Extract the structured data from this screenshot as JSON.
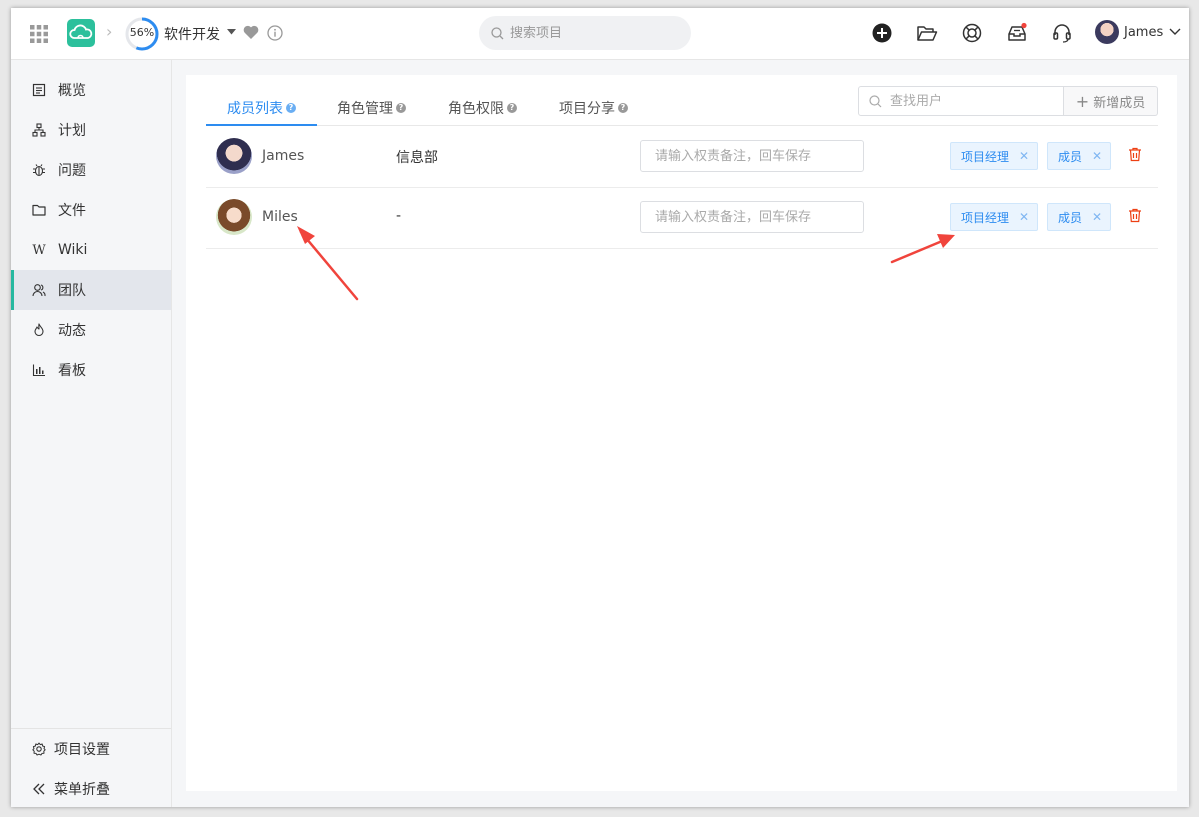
{
  "topbar": {
    "progress_percent": 56,
    "progress_label": "56%",
    "project_name": "软件开发",
    "search_placeholder": "搜索项目",
    "user_name": "James",
    "icons": [
      "apps-grid-icon",
      "cloud-logo",
      "heart-icon",
      "info-icon",
      "add-circle-icon",
      "folder-open-icon",
      "lifebuoy-icon",
      "inbox-icon",
      "headset-icon"
    ]
  },
  "sidebar": {
    "items": [
      {
        "label": "概览",
        "icon": "overview-icon"
      },
      {
        "label": "计划",
        "icon": "plan-icon"
      },
      {
        "label": "问题",
        "icon": "bug-icon"
      },
      {
        "label": "文件",
        "icon": "folder-icon"
      },
      {
        "label": "Wiki",
        "icon": "wiki-icon"
      },
      {
        "label": "团队",
        "icon": "team-icon",
        "active": true
      },
      {
        "label": "动态",
        "icon": "fire-icon"
      },
      {
        "label": "看板",
        "icon": "chart-icon"
      }
    ],
    "settings_label": "项目设置",
    "collapse_label": "菜单折叠"
  },
  "main": {
    "tabs": [
      {
        "label": "成员列表",
        "active": true
      },
      {
        "label": "角色管理"
      },
      {
        "label": "角色权限"
      },
      {
        "label": "项目分享"
      }
    ],
    "user_search_placeholder": "查找用户",
    "add_member_label": "新增成员",
    "members": [
      {
        "name": "James",
        "department": "信息部",
        "note_placeholder": "请输入权责备注，回车保存",
        "roles": [
          "项目经理",
          "成员"
        ]
      },
      {
        "name": "Miles",
        "department": "-",
        "note_placeholder": "请输入权责备注，回车保存",
        "roles": [
          "项目经理",
          "成员"
        ]
      }
    ]
  },
  "colors": {
    "accent_blue": "#2d8cf0",
    "brand_teal": "#2cc09c",
    "annotation_red": "#f0443c"
  }
}
